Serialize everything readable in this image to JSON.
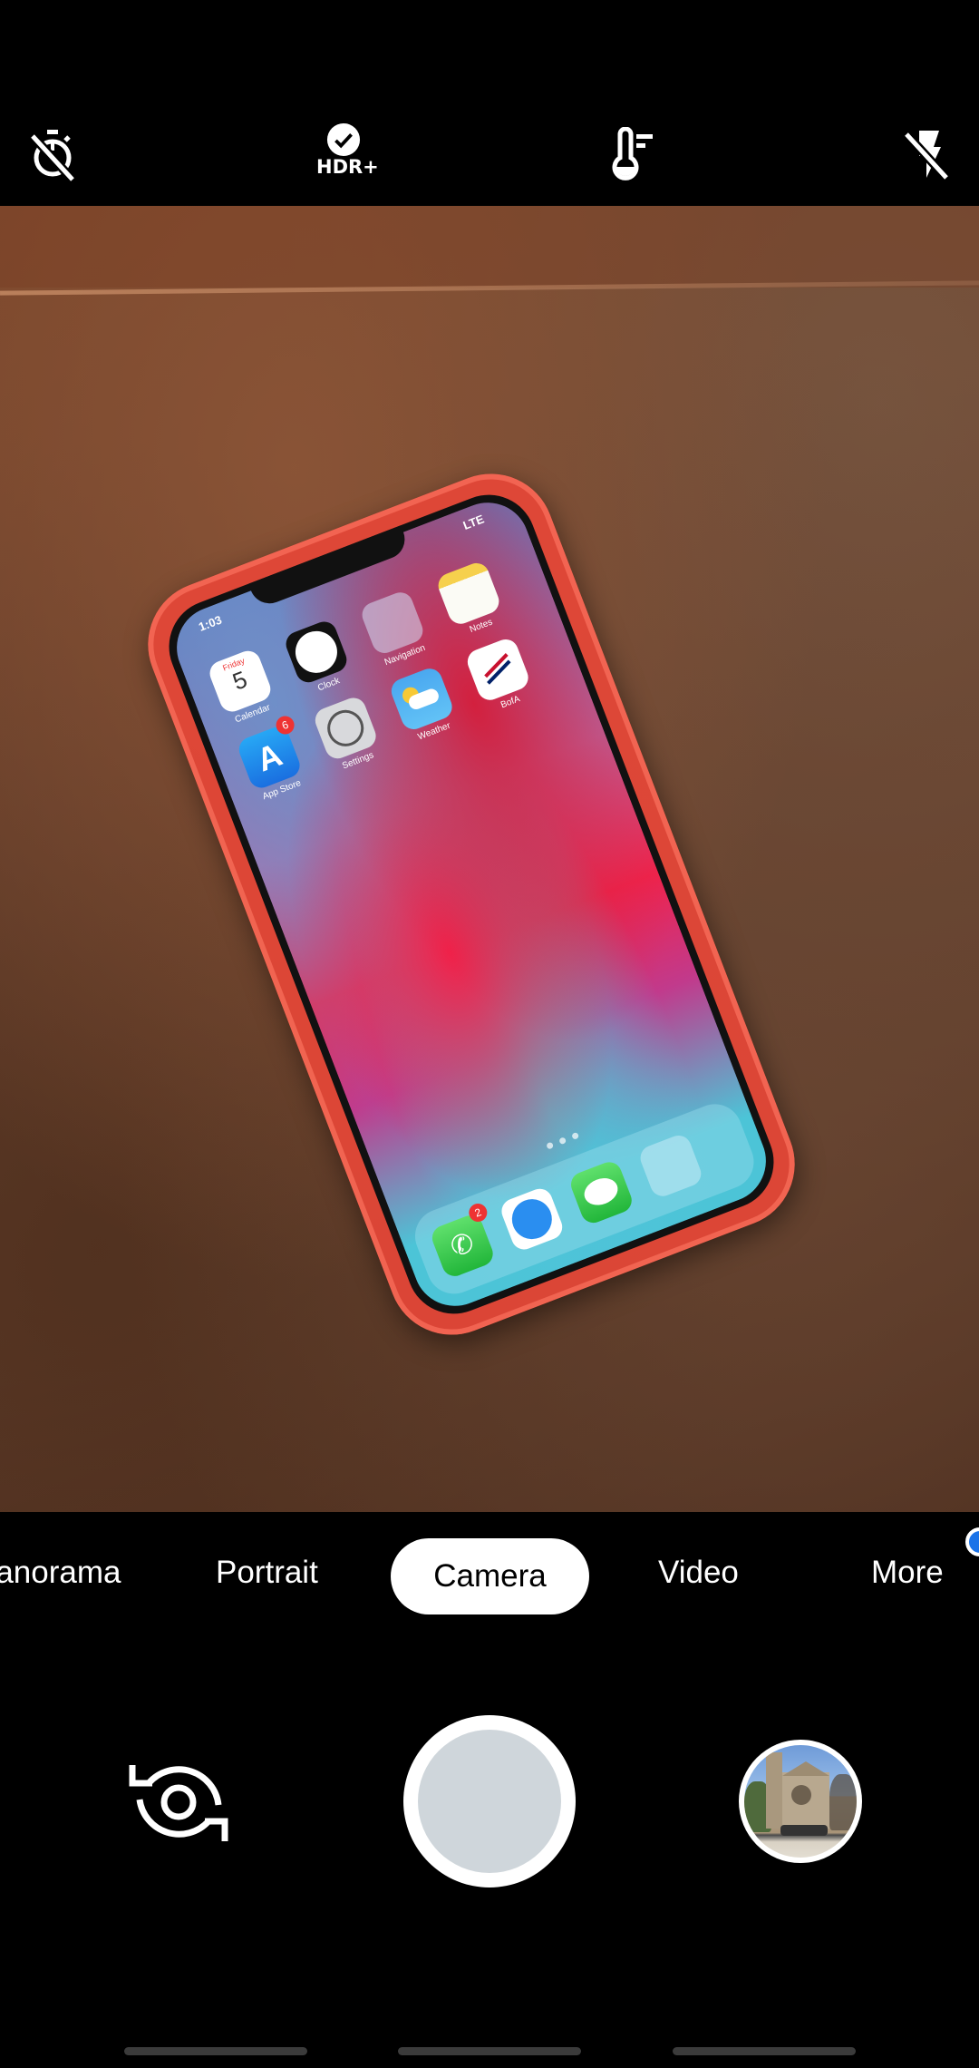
{
  "top_bar": {
    "icons": [
      {
        "name": "timer-off-icon",
        "label": "Timer off"
      },
      {
        "name": "hdr-plus-icon",
        "label": "HDR+"
      },
      {
        "name": "white-balance-icon",
        "label": "White balance"
      },
      {
        "name": "flash-off-icon",
        "label": "Flash off"
      }
    ],
    "hdr_label": "HDR+"
  },
  "viewfinder": {
    "subject": "iPhone in red case on brown tile table",
    "phone_screen": {
      "time": "1:03",
      "network": "LTE",
      "apps": [
        {
          "label": "Calendar",
          "day": "Friday",
          "date": "5"
        },
        {
          "label": "Clock"
        },
        {
          "label": "Navigation"
        },
        {
          "label": "Notes"
        },
        {
          "label": "App Store",
          "badge": "6"
        },
        {
          "label": "Settings"
        },
        {
          "label": "Weather"
        },
        {
          "label": "BofA"
        }
      ],
      "dock": [
        {
          "label": "Phone",
          "badge": "2"
        },
        {
          "label": "Safari"
        },
        {
          "label": "Messages"
        },
        {
          "label": "Folder"
        }
      ]
    },
    "lens_button": "google-lens-icon"
  },
  "modes": {
    "items": [
      "Panorama",
      "Portrait",
      "Camera",
      "Video",
      "More"
    ],
    "selected": "Camera",
    "more_has_notification_dot": true
  },
  "controls": {
    "switch_camera": "switch-camera-icon",
    "shutter": "shutter-button",
    "thumbnail": "last-photo-thumbnail"
  },
  "colors": {
    "background": "#000000",
    "shutter_inner": "#cfd6db",
    "selected_mode_bg": "#ffffff",
    "notification_dot": "#1a73e8",
    "nav_pill": "#3b3b3b"
  }
}
